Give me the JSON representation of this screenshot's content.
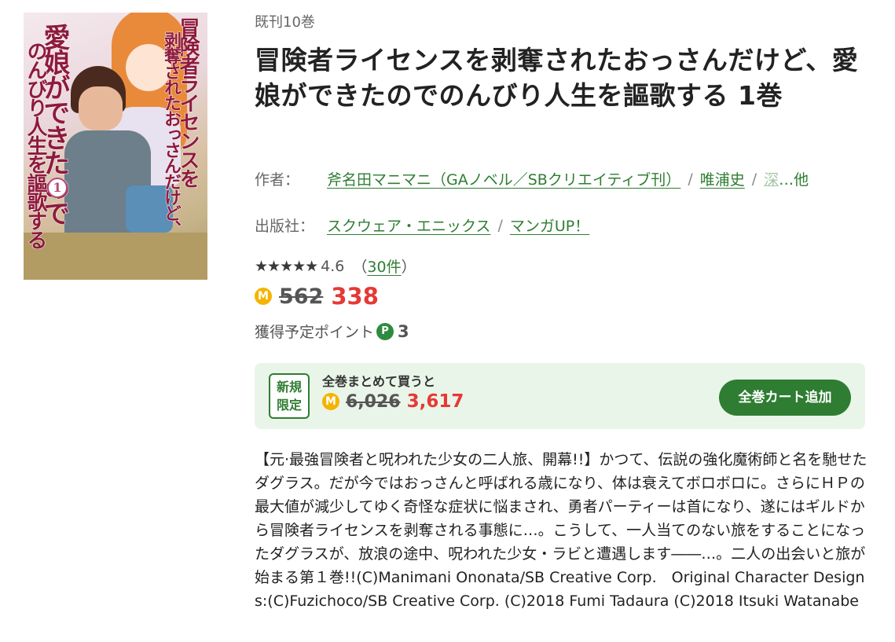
{
  "cover": {
    "title_line1": "冒険者ライセンスを",
    "title_line2": "剥奪されたおっさんだけど、",
    "title_line3": "愛娘ができたので",
    "title_line4": "のんびり人生を謳歌する",
    "volume": "1"
  },
  "issued": "既刊10巻",
  "title": "冒険者ライセンスを剥奪されたおっさんだけど、愛娘ができたのでのんびり人生を謳歌する 1巻",
  "author": {
    "label": "作者：",
    "names": [
      "斧名田マニマニ（GAノベル／SBクリエイティブ刊）",
      "唯浦史",
      "深"
    ],
    "more": "…他"
  },
  "publisher": {
    "label": "出版社：",
    "names": [
      "スクウェア・エニックス",
      "マンガUP！"
    ]
  },
  "rating": {
    "stars": 4.6,
    "stars_glyph": "★★★★★",
    "value": "4.6",
    "open": "（",
    "count": "30件",
    "close": "）"
  },
  "price": {
    "coin_label": "M",
    "original": "562",
    "sale": "338"
  },
  "points": {
    "label": "獲得予定ポイント",
    "badge": "P",
    "value": "3"
  },
  "promo": {
    "tag_line1": "新規",
    "tag_line2": "限定",
    "caption": "全巻まとめて買うと",
    "coin_label": "M",
    "original": "6,026",
    "sale": "3,617",
    "button": "全巻カート追加"
  },
  "description": "【元·最強冒険者と呪われた少女の二人旅、開幕!!】かつて、伝説の強化魔術師と名を馳せたダグラス。だが今ではおっさんと呼ばれる歳になり、体は衰えてボロボロに。さらにＨＰの最大値が減少してゆく奇怪な症状に悩まされ、勇者パーティーは首になり、遂にはギルドから冒険者ライセンスを剥奪される事態に…。こうして、一人当てのない旅をすることになったダグラスが、放浪の途中、呪われた少女・ラビと遭遇します――…。二人の出会いと旅が始まる第１巻!!(C)Manimani Ononata/SB Creative Corp.　Original Character Designs:(C)Fuzichoco/SB Creative Corp. (C)2018 Fumi Tadaura (C)2018 Itsuki Watanabe",
  "colors": {
    "link": "#2e7d32",
    "sale_red": "#e53935",
    "coin": "#f4b400",
    "promo_bg": "#e9f5e8",
    "button": "#2e7d32"
  }
}
